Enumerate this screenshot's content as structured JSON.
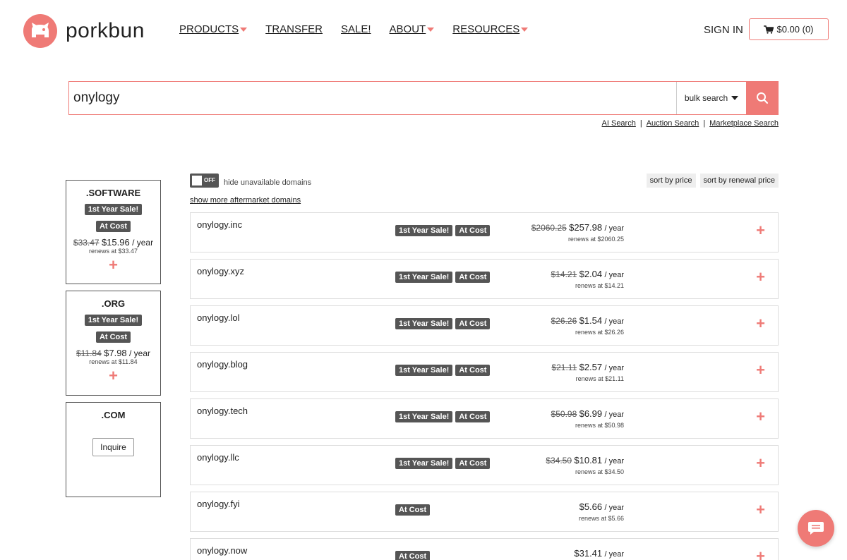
{
  "brand": {
    "name": "porkbun",
    "color": "#ef7a76"
  },
  "nav": [
    {
      "label": "PRODUCTS",
      "dropdown": true
    },
    {
      "label": "TRANSFER",
      "dropdown": false
    },
    {
      "label": "SALE!",
      "dropdown": false
    },
    {
      "label": "ABOUT",
      "dropdown": true
    },
    {
      "label": "RESOURCES",
      "dropdown": true
    }
  ],
  "header": {
    "signin": "SIGN IN",
    "cart": "$0.00 (0)"
  },
  "search": {
    "value": "onylogy",
    "mode": "bulk search",
    "links": [
      "AI Search",
      "Auction Search",
      "Marketplace Search"
    ]
  },
  "controls": {
    "toggle_state": "OFF",
    "toggle_label": "hide unavailable domains",
    "aftermarket": "show more aftermarket domains",
    "sort_price": "sort by price",
    "sort_renewal": "sort by renewal price"
  },
  "sidebar": [
    {
      "tld": ".SOFTWARE",
      "badges": [
        "1st Year Sale!",
        "At Cost"
      ],
      "old_price": "$33.47",
      "price": "$15.96",
      "unit": "/ year",
      "renews": "renews at $33.47"
    },
    {
      "tld": ".ORG",
      "badges": [
        "1st Year Sale!",
        "At Cost"
      ],
      "old_price": "$11.84",
      "price": "$7.98",
      "unit": "/ year",
      "renews": "renews at $11.84"
    },
    {
      "tld": ".COM",
      "inquire": "Inquire"
    }
  ],
  "results": [
    {
      "domain": "onylogy.inc",
      "badges": [
        "1st Year Sale!",
        "At Cost"
      ],
      "old_price": "$2060.25",
      "price": "$257.98",
      "unit": "/ year",
      "renews": "renews at $2060.25"
    },
    {
      "domain": "onylogy.xyz",
      "badges": [
        "1st Year Sale!",
        "At Cost"
      ],
      "old_price": "$14.21",
      "price": "$2.04",
      "unit": "/ year",
      "renews": "renews at $14.21"
    },
    {
      "domain": "onylogy.lol",
      "badges": [
        "1st Year Sale!",
        "At Cost"
      ],
      "old_price": "$26.26",
      "price": "$1.54",
      "unit": "/ year",
      "renews": "renews at $26.26"
    },
    {
      "domain": "onylogy.blog",
      "badges": [
        "1st Year Sale!",
        "At Cost"
      ],
      "old_price": "$21.11",
      "price": "$2.57",
      "unit": "/ year",
      "renews": "renews at $21.11"
    },
    {
      "domain": "onylogy.tech",
      "badges": [
        "1st Year Sale!",
        "At Cost"
      ],
      "old_price": "$50.98",
      "price": "$6.99",
      "unit": "/ year",
      "renews": "renews at $50.98"
    },
    {
      "domain": "onylogy.llc",
      "badges": [
        "1st Year Sale!",
        "At Cost"
      ],
      "old_price": "$34.50",
      "price": "$10.81",
      "unit": "/ year",
      "renews": "renews at $34.50"
    },
    {
      "domain": "onylogy.fyi",
      "badges": [
        "At Cost"
      ],
      "old_price": "",
      "price": "$5.66",
      "unit": "/ year",
      "renews": "renews at $5.66"
    },
    {
      "domain": "onylogy.now",
      "badges": [
        "At Cost"
      ],
      "old_price": "",
      "price": "$31.41",
      "unit": "/ year",
      "renews": ""
    }
  ],
  "icons": {
    "logo": "pig-icon",
    "cart": "cart-icon",
    "search": "search-icon",
    "add": "plus-icon",
    "chat": "chat-icon"
  }
}
